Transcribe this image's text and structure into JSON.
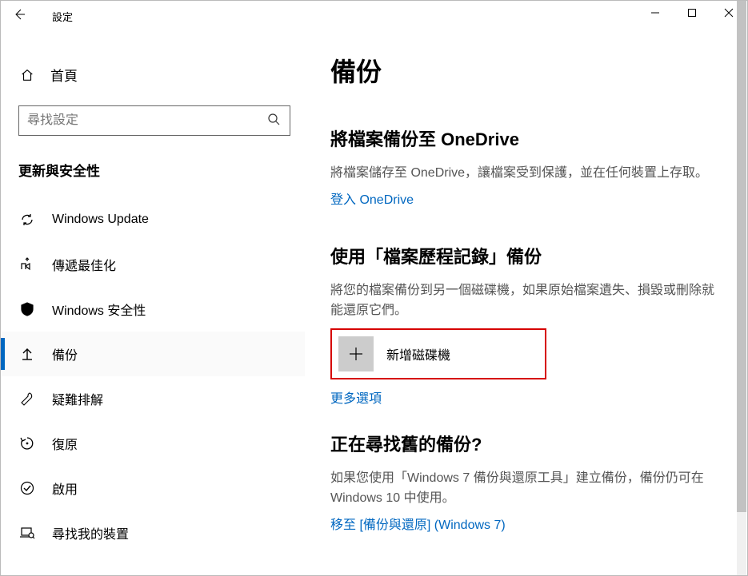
{
  "window": {
    "app_title": "設定"
  },
  "sidebar": {
    "home_label": "首頁",
    "search_placeholder": "尋找設定",
    "category_label": "更新與安全性",
    "items": [
      {
        "label": "Windows Update"
      },
      {
        "label": "傳遞最佳化"
      },
      {
        "label": "Windows 安全性"
      },
      {
        "label": "備份"
      },
      {
        "label": "疑難排解"
      },
      {
        "label": "復原"
      },
      {
        "label": "啟用"
      },
      {
        "label": "尋找我的裝置"
      }
    ]
  },
  "content": {
    "page_title": "備份",
    "onedrive": {
      "title": "將檔案備份至 OneDrive",
      "desc": "將檔案儲存至 OneDrive，讓檔案受到保護，並在任何裝置上存取。",
      "link": "登入 OneDrive"
    },
    "filehistory": {
      "title": "使用「檔案歷程記錄」備份",
      "desc": "將您的檔案備份到另一個磁碟機，如果原始檔案遺失、損毀或刪除就能還原它們。",
      "add_drive": "新增磁碟機",
      "more_options": "更多選項"
    },
    "oldbackup": {
      "title": "正在尋找舊的備份?",
      "desc": "如果您使用「Windows 7 備份與還原工具」建立備份，備份仍可在 Windows 10 中使用。",
      "link": "移至 [備份與還原] (Windows 7)"
    }
  }
}
